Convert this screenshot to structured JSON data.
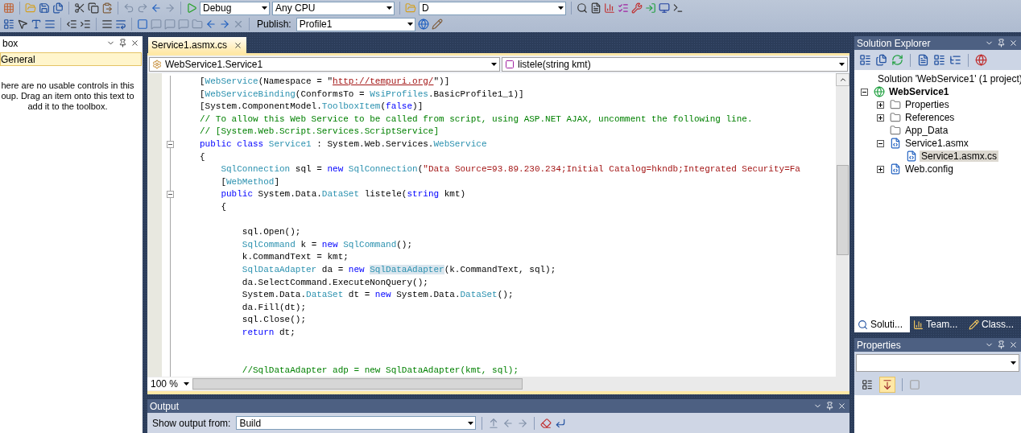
{
  "toolbar": {
    "build_config": "Debug",
    "platform": "Any CPU",
    "find_box": "D",
    "publish_label": "Publish:",
    "publish_profile": "Profile1"
  },
  "toolbox": {
    "title": "box",
    "group": "General",
    "message": "here are no usable controls in this oup. Drag an item onto this text to add it to the toolbox."
  },
  "editor": {
    "tabs": [
      {
        "label": "Service1.asmx.cs",
        "selected": true
      }
    ],
    "type_dropdown": "WebService1.Service1",
    "member_dropdown": "listele(string kmt)",
    "zoom": "100 %",
    "lines": [
      {
        "kind": "code",
        "tokens": [
          {
            "kind": "plain",
            "text": "["
          },
          {
            "kind": "type",
            "text": "WebService"
          },
          {
            "kind": "plain",
            "text": "(Namespace = \""
          },
          {
            "kind": "url",
            "text": "http://tempuri.org/"
          },
          {
            "kind": "plain",
            "text": "\")]"
          }
        ]
      },
      {
        "kind": "code",
        "tokens": [
          {
            "kind": "plain",
            "text": "["
          },
          {
            "kind": "type",
            "text": "WebServiceBinding"
          },
          {
            "kind": "plain",
            "text": "(ConformsTo = "
          },
          {
            "kind": "type",
            "text": "WsiProfiles"
          },
          {
            "kind": "plain",
            "text": ".BasicProfile1_1)]"
          }
        ]
      },
      {
        "kind": "code",
        "tokens": [
          {
            "kind": "plain",
            "text": "[System.ComponentModel."
          },
          {
            "kind": "type",
            "text": "ToolboxItem"
          },
          {
            "kind": "plain",
            "text": "("
          },
          {
            "kind": "keyword",
            "text": "false"
          },
          {
            "kind": "plain",
            "text": ")]"
          }
        ]
      },
      {
        "kind": "code",
        "tokens": [
          {
            "kind": "comment",
            "text": "// To allow this Web Service to be called from script, using ASP.NET AJAX, uncomment the following line."
          }
        ]
      },
      {
        "kind": "code",
        "tokens": [
          {
            "kind": "comment",
            "text": "// [System.Web.Script.Services.ScriptService]"
          }
        ]
      },
      {
        "kind": "code",
        "expanded": true,
        "tokens": [
          {
            "kind": "keyword",
            "text": "public class "
          },
          {
            "kind": "type",
            "text": "Service1"
          },
          {
            "kind": "plain",
            "text": " : System.Web.Services."
          },
          {
            "kind": "type",
            "text": "WebService"
          }
        ]
      },
      {
        "kind": "code",
        "tokens": [
          {
            "kind": "plain",
            "text": "{"
          }
        ]
      },
      {
        "kind": "code",
        "tokens": [
          {
            "kind": "type",
            "text": "    SqlConnection"
          },
          {
            "kind": "plain",
            "text": " sql = "
          },
          {
            "kind": "keyword",
            "text": "new "
          },
          {
            "kind": "type",
            "text": "SqlConnection"
          },
          {
            "kind": "plain",
            "text": "("
          },
          {
            "kind": "string",
            "text": "\"Data Source=93.89.230.234;Initial Catalog=hkndb;Integrated Security=Fa"
          }
        ]
      },
      {
        "kind": "code",
        "tokens": [
          {
            "kind": "plain",
            "text": "    ["
          },
          {
            "kind": "type",
            "text": "WebMethod"
          },
          {
            "kind": "plain",
            "text": "]"
          }
        ]
      },
      {
        "kind": "code",
        "expanded": true,
        "tokens": [
          {
            "kind": "keyword",
            "text": "    public"
          },
          {
            "kind": "plain",
            "text": " System.Data."
          },
          {
            "kind": "type",
            "text": "DataSet"
          },
          {
            "kind": "plain",
            "text": " listele("
          },
          {
            "kind": "keyword",
            "text": "string"
          },
          {
            "kind": "plain",
            "text": " kmt)"
          }
        ]
      },
      {
        "kind": "code",
        "tokens": [
          {
            "kind": "plain",
            "text": "    {"
          }
        ]
      },
      {
        "kind": "blank"
      },
      {
        "kind": "code",
        "tokens": [
          {
            "kind": "plain",
            "text": "        sql.Open();"
          }
        ]
      },
      {
        "kind": "code",
        "tokens": [
          {
            "kind": "type",
            "text": "        SqlCommand"
          },
          {
            "kind": "plain",
            "text": " k = "
          },
          {
            "kind": "keyword",
            "text": "new "
          },
          {
            "kind": "type",
            "text": "SqlCommand"
          },
          {
            "kind": "plain",
            "text": "();"
          }
        ]
      },
      {
        "kind": "code",
        "tokens": [
          {
            "kind": "plain",
            "text": "        k.CommandText = kmt;"
          }
        ]
      },
      {
        "kind": "code",
        "tokens": [
          {
            "kind": "type",
            "text": "        SqlDataAdapter"
          },
          {
            "kind": "plain",
            "text": " da = "
          },
          {
            "kind": "keyword",
            "text": "new "
          },
          {
            "kind": "highlight",
            "text": "SqlDataAdapter"
          },
          {
            "kind": "plain",
            "text": "(k.CommandText, sql);"
          }
        ]
      },
      {
        "kind": "code",
        "tokens": [
          {
            "kind": "plain",
            "text": "        da.SelectCommand.ExecuteNonQuery();"
          }
        ]
      },
      {
        "kind": "code",
        "tokens": [
          {
            "kind": "plain",
            "text": "        System.Data."
          },
          {
            "kind": "type",
            "text": "DataSet"
          },
          {
            "kind": "plain",
            "text": " dt = "
          },
          {
            "kind": "keyword",
            "text": "new"
          },
          {
            "kind": "plain",
            "text": " System.Data."
          },
          {
            "kind": "type",
            "text": "DataSet"
          },
          {
            "kind": "plain",
            "text": "();"
          }
        ]
      },
      {
        "kind": "code",
        "tokens": [
          {
            "kind": "plain",
            "text": "        da.Fill(dt);"
          }
        ]
      },
      {
        "kind": "code",
        "tokens": [
          {
            "kind": "plain",
            "text": "        sql.Close();"
          }
        ]
      },
      {
        "kind": "code",
        "tokens": [
          {
            "kind": "keyword",
            "text": "        return"
          },
          {
            "kind": "plain",
            "text": " dt;"
          }
        ]
      },
      {
        "kind": "blank"
      },
      {
        "kind": "blank"
      },
      {
        "kind": "code",
        "tokens": [
          {
            "kind": "comment",
            "text": "        //SqlDataAdapter adp = new SqlDataAdapter(kmt, sql);"
          }
        ]
      }
    ]
  },
  "output": {
    "title": "Output",
    "source_label": "Show output from:",
    "source": "Build"
  },
  "solution_explorer": {
    "title": "Solution Explorer",
    "tree": [
      {
        "kind": "solution",
        "label": "Solution 'WebService1' (1 project)",
        "selected": false,
        "children": [
          {
            "kind": "project",
            "label": "WebService1",
            "expanded": true,
            "selected": false,
            "children": [
              {
                "kind": "folder",
                "label": "Properties",
                "expanded": false,
                "selected": false
              },
              {
                "kind": "folder",
                "label": "References",
                "expanded": false,
                "selected": false
              },
              {
                "kind": "folder",
                "label": "App_Data",
                "selected": false
              },
              {
                "kind": "file",
                "label": "Service1.asmx",
                "expanded": true,
                "selected": false,
                "children": [
                  {
                    "kind": "file",
                    "label": "Service1.asmx.cs",
                    "selected": true
                  }
                ]
              },
              {
                "kind": "file",
                "label": "Web.config",
                "expanded": false,
                "selected": false
              }
            ]
          }
        ]
      }
    ],
    "tabs": [
      {
        "label": "Soluti...",
        "selected": true
      },
      {
        "label": "Team...",
        "selected": false
      },
      {
        "label": "Class...",
        "selected": false
      }
    ]
  },
  "properties": {
    "title": "Properties",
    "sort_buttons": [
      {
        "selected": false
      },
      {
        "selected": true
      }
    ]
  }
}
